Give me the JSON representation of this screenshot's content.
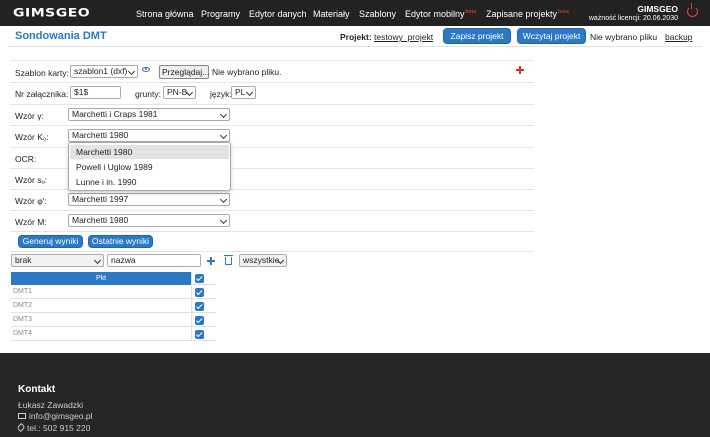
{
  "nav": {
    "logo": "GIMSGEO",
    "items": [
      {
        "label": "Strona główna"
      },
      {
        "label": "Programy"
      },
      {
        "label": "Edytor danych"
      },
      {
        "label": "Materiały"
      },
      {
        "label": "Szablony"
      },
      {
        "label": "Edytor mobilny",
        "badge": "beta"
      },
      {
        "label": "Zapisane projekty",
        "badge": "beta"
      }
    ],
    "user": "GIMSGEO",
    "license": "ważność licencji: 20.06.2030"
  },
  "header": {
    "title": "Sondowania DMT",
    "project_label": "Projekt:",
    "project_name": "testowy_projekt",
    "save_button": "Zapisz projekt",
    "load_button": "Wczytaj projekt",
    "no_file": "Nie wybrano pliku",
    "backup": "backup"
  },
  "form": {
    "template_label": "Szablon karty:",
    "template_value": "szablon1 (dxf)",
    "browse_label": "Przeglądaj...",
    "browse_status": "Nie wybrano pliku.",
    "attachment_label": "Nr załącznika:",
    "attachment_value": "$1$",
    "soils_label": "grunty:",
    "soils_value": "PN-B",
    "language_label": "język:",
    "language_value": "PL",
    "gamma_label": "Wzór γ:",
    "gamma_value": "Marchetti i Craps 1981",
    "k0_label": "Wzór K₀:",
    "k0_value": "Marchetti 1980",
    "ocr_label": "OCR:",
    "su_label": "Wzór sᵤ:",
    "phi_label": "Wzór φ':",
    "phi_value": "Marchetti 1997",
    "m_label": "Wzór M:",
    "m_value": "Marchetti 1980",
    "generate_button": "Generuj wyniki",
    "last_button": "Ostatnie wyniki"
  },
  "dropdown": {
    "options": [
      "Marchetti 1980",
      "Powell i Uglow 1989",
      "Lunne i in. 1990"
    ],
    "selected_index": 0
  },
  "table_controls": {
    "filter_value": "brak",
    "name_value": "nazwa",
    "scope_value": "wszystkie"
  },
  "table": {
    "header": "Pkt",
    "rows": [
      {
        "name": "DMT1",
        "checked": true
      },
      {
        "name": "DMT2",
        "checked": true
      },
      {
        "name": "DMT3",
        "checked": true
      },
      {
        "name": "DMT4",
        "checked": true
      }
    ]
  },
  "footer": {
    "title": "Kontakt",
    "person": "Łukasz Zawadzki",
    "email": "info@gimsgeo.pl",
    "phone": "tel.: 502 915 220"
  }
}
